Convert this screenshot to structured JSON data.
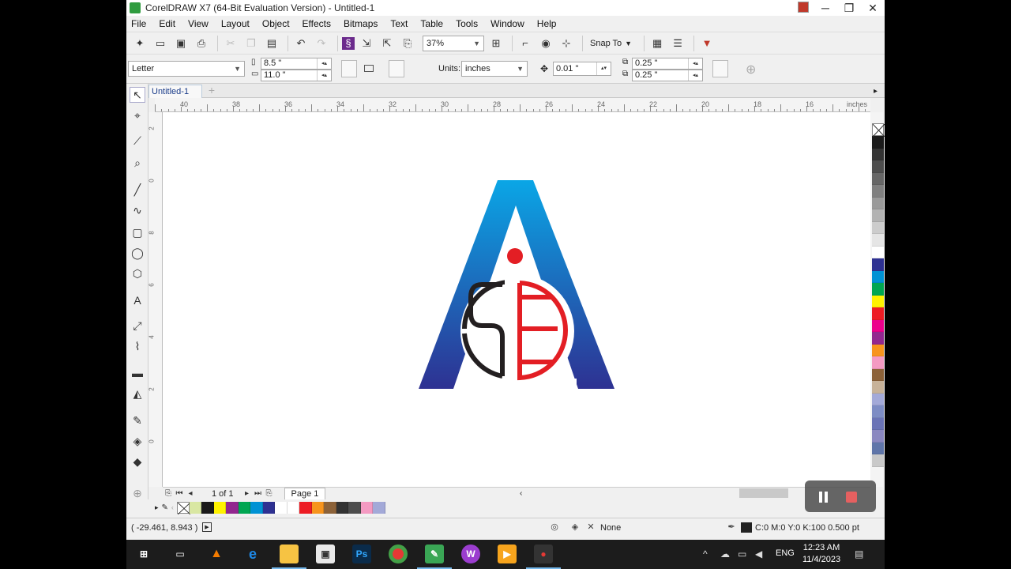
{
  "window": {
    "title": "CorelDRAW X7 (64-Bit Evaluation Version) - Untitled-1",
    "min": "─",
    "max": "❐",
    "close": "✕"
  },
  "menu": [
    "File",
    "Edit",
    "View",
    "Layout",
    "Object",
    "Effects",
    "Bitmaps",
    "Text",
    "Table",
    "Tools",
    "Window",
    "Help"
  ],
  "toolbar": {
    "zoom": "37%",
    "snap_label": "Snap To"
  },
  "propbar": {
    "page_size": "Letter",
    "width": "8.5 \"",
    "height": "11.0 \"",
    "units_label": "Units:",
    "units": "inches",
    "nudge": "0.01 \"",
    "dup_x": "0.25 \"",
    "dup_y": "0.25 \""
  },
  "document": {
    "tab": "Untitled-1",
    "page_tab": "Page 1",
    "page_count": "1 of 1"
  },
  "ruler": {
    "units": "inches",
    "h_ticks": [
      "40",
      "38",
      "36",
      "34",
      "32",
      "30",
      "28",
      "26",
      "24",
      "22",
      "20",
      "18",
      "16"
    ],
    "v_ticks": [
      "2",
      "0",
      "8",
      "6",
      "4",
      "2",
      "0"
    ]
  },
  "palette_colors": [
    "#1a1a1a",
    "#333333",
    "#4d4d4d",
    "#666666",
    "#7f7f7f",
    "#999999",
    "#b2b2b2",
    "#cccccc",
    "#e5e5e5",
    "#ffffff",
    "#2e3192",
    "#0092d4",
    "#00a651",
    "#fff200",
    "#ed1c24",
    "#ec008c",
    "#92278f",
    "#f7941d",
    "#f49ac2",
    "#8c6239",
    "#c7b299",
    "#a3a9d8",
    "#7d8cc4",
    "#6a73b6",
    "#8a87c0",
    "#5f75a9",
    "#c9c9c9"
  ],
  "doc_palette_colors": [
    "#d9e7a3",
    "#1a1a1a",
    "#fff200",
    "#92278f",
    "#00a651",
    "#0092d4",
    "#2e3192",
    "#ffffff",
    "#ffffff",
    "#ed1c24",
    "#f7941d",
    "#8c6239",
    "#333333",
    "#4d4d4d",
    "#f49ac2",
    "#a3a9d8"
  ],
  "status": {
    "coords": "( -29.461, 8.943 )",
    "fill": "None",
    "outline": "C:0 M:0 Y:0 K:100  0.500 pt"
  },
  "logo": {
    "letters": [
      "S",
      "E"
    ],
    "gradient_top": "#0aa6e6",
    "gradient_bottom": "#2e3192",
    "dot_color": "#e31e24",
    "s_color": "#231f20",
    "e_color": "#e31e24"
  },
  "taskbar": {
    "lang": "ENG",
    "time": "12:23 AM",
    "date": "11/4/2023"
  }
}
